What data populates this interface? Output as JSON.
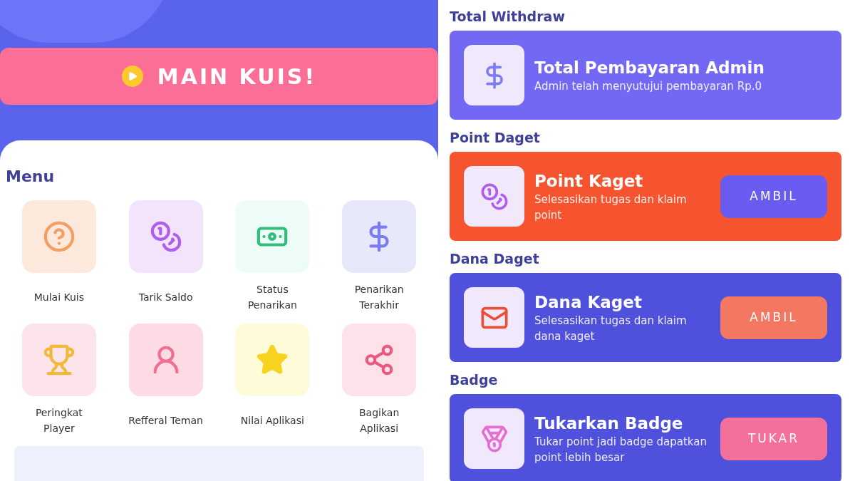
{
  "quiz_button": {
    "label": "MAIN KUIS!"
  },
  "menu": {
    "title": "Menu",
    "items": [
      {
        "label": "Mulai Kuis",
        "kind": "question",
        "color": "#fde8dc"
      },
      {
        "label": "Tarik Saldo",
        "kind": "coins",
        "color": "#f3e3fb"
      },
      {
        "label": "Status Penarikan",
        "kind": "banknote",
        "color": "#eefcf7"
      },
      {
        "label": "Penarikan Terakhir",
        "kind": "dollar",
        "color": "#e8e8fb"
      },
      {
        "label": "Peringkat Player",
        "kind": "trophy",
        "color": "#fde4ea"
      },
      {
        "label": "Refferal Teman",
        "kind": "person",
        "color": "#fcdbe4"
      },
      {
        "label": "Nilai Aplikasi",
        "kind": "star",
        "color": "#fefbd8"
      },
      {
        "label": "Bagikan Aplikasi",
        "kind": "share",
        "color": "#fde2ea"
      }
    ]
  },
  "sections": [
    {
      "heading": "Total Withdraw",
      "title": "Total Pembayaran Admin",
      "subtitle": "Admin telah menyutujui pembayaran Rp.0",
      "kind": "dollar",
      "color": "#7268f3"
    },
    {
      "heading": "Point Daget",
      "title": "Point Kaget",
      "subtitle": "Selesasikan tugas dan klaim point",
      "kind": "coins",
      "color": "#f6532f",
      "button": {
        "label": "AMBIL",
        "color": "#6a5cf0"
      }
    },
    {
      "heading": "Dana Daget",
      "title": "Dana Kaget",
      "subtitle": "Selesasikan tugas dan klaim dana kaget",
      "kind": "envelope",
      "color": "#4f50dc",
      "button": {
        "label": "AMBIL",
        "color": "#f47762"
      }
    },
    {
      "heading": "Badge",
      "title": "Tukarkan Badge",
      "subtitle": "Tukar point jadi badge dapatkan point lebih besar",
      "kind": "medal",
      "color": "#4f50dc",
      "button": {
        "label": "TUKAR",
        "color": "#f2709a"
      }
    }
  ]
}
